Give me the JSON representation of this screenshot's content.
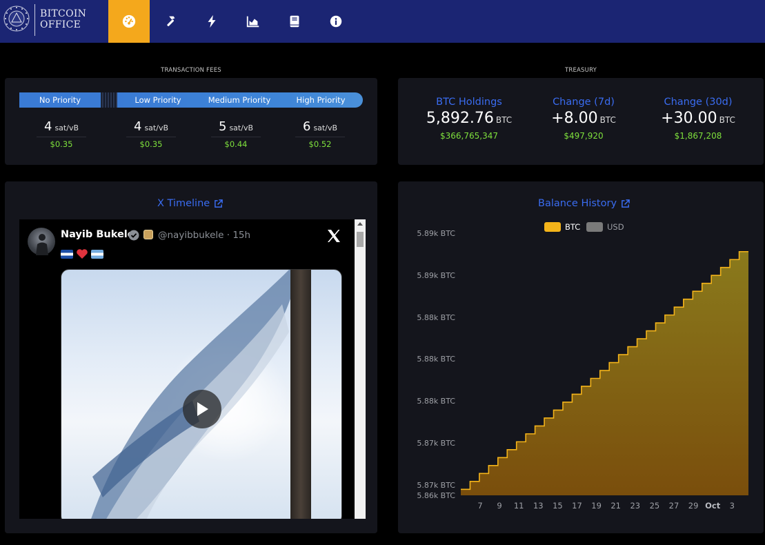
{
  "header": {
    "logo_line1": "BITCOIN",
    "logo_line2": "OFFICE",
    "nav": [
      {
        "icon": "dashboard-gauge-icon",
        "active": true
      },
      {
        "icon": "hammer-icon",
        "active": false
      },
      {
        "icon": "lightning-icon",
        "active": false
      },
      {
        "icon": "area-chart-icon",
        "active": false
      },
      {
        "icon": "book-icon",
        "active": false
      },
      {
        "icon": "info-icon",
        "active": false
      }
    ]
  },
  "fees": {
    "section_label": "TRANSACTION FEES",
    "priorities": [
      "No Priority",
      "Low Priority",
      "Medium Priority",
      "High Priority"
    ],
    "items": [
      {
        "rate": "4",
        "unit": "sat/vB",
        "usd": "$0.35"
      },
      {
        "rate": "4",
        "unit": "sat/vB",
        "usd": "$0.35"
      },
      {
        "rate": "5",
        "unit": "sat/vB",
        "usd": "$0.44"
      },
      {
        "rate": "6",
        "unit": "sat/vB",
        "usd": "$0.52"
      }
    ]
  },
  "treasury": {
    "section_label": "TREASURY",
    "items": [
      {
        "title": "BTC Holdings",
        "value": "5,892.76",
        "unit": "BTC",
        "usd": "$366,765,347"
      },
      {
        "title": "Change (7d)",
        "value": "+8.00",
        "unit": "BTC",
        "usd": "$497,920"
      },
      {
        "title": "Change (30d)",
        "value": "+30.00",
        "unit": "BTC",
        "usd": "$1,867,208"
      }
    ]
  },
  "timeline": {
    "title": "X Timeline",
    "tweet": {
      "name": "Nayib Bukele",
      "handle_time": "@nayibbukele · 15h"
    }
  },
  "balance": {
    "title": "Balance History",
    "legend": [
      {
        "label": "BTC",
        "color": "#f4b41a"
      },
      {
        "label": "USD",
        "color": "#7a7a7a"
      }
    ]
  },
  "chart_data": {
    "type": "area",
    "title": "Balance History",
    "series": [
      {
        "name": "BTC",
        "values": [
          5862.76,
          5863.76,
          5864.76,
          5865.76,
          5866.76,
          5867.76,
          5868.76,
          5869.76,
          5870.76,
          5871.76,
          5872.76,
          5873.76,
          5874.76,
          5875.76,
          5876.76,
          5877.76,
          5878.76,
          5879.76,
          5880.76,
          5881.76,
          5882.76,
          5883.76,
          5884.76,
          5885.76,
          5886.76,
          5887.76,
          5888.76,
          5889.76,
          5890.76,
          5891.76,
          5892.76
        ]
      }
    ],
    "ylim": [
      5862.0,
      5893.0
    ],
    "y_ticks": [
      "5.89k BTC",
      "5.89k BTC",
      "5.88k BTC",
      "5.88k BTC",
      "5.88k BTC",
      "5.87k BTC",
      "5.87k BTC",
      "5.86k BTC"
    ],
    "x_ticks": [
      "7",
      "9",
      "11",
      "13",
      "15",
      "17",
      "19",
      "21",
      "23",
      "25",
      "27",
      "29",
      "Oct",
      "3"
    ],
    "legend_position": "top-center",
    "grid": false
  }
}
